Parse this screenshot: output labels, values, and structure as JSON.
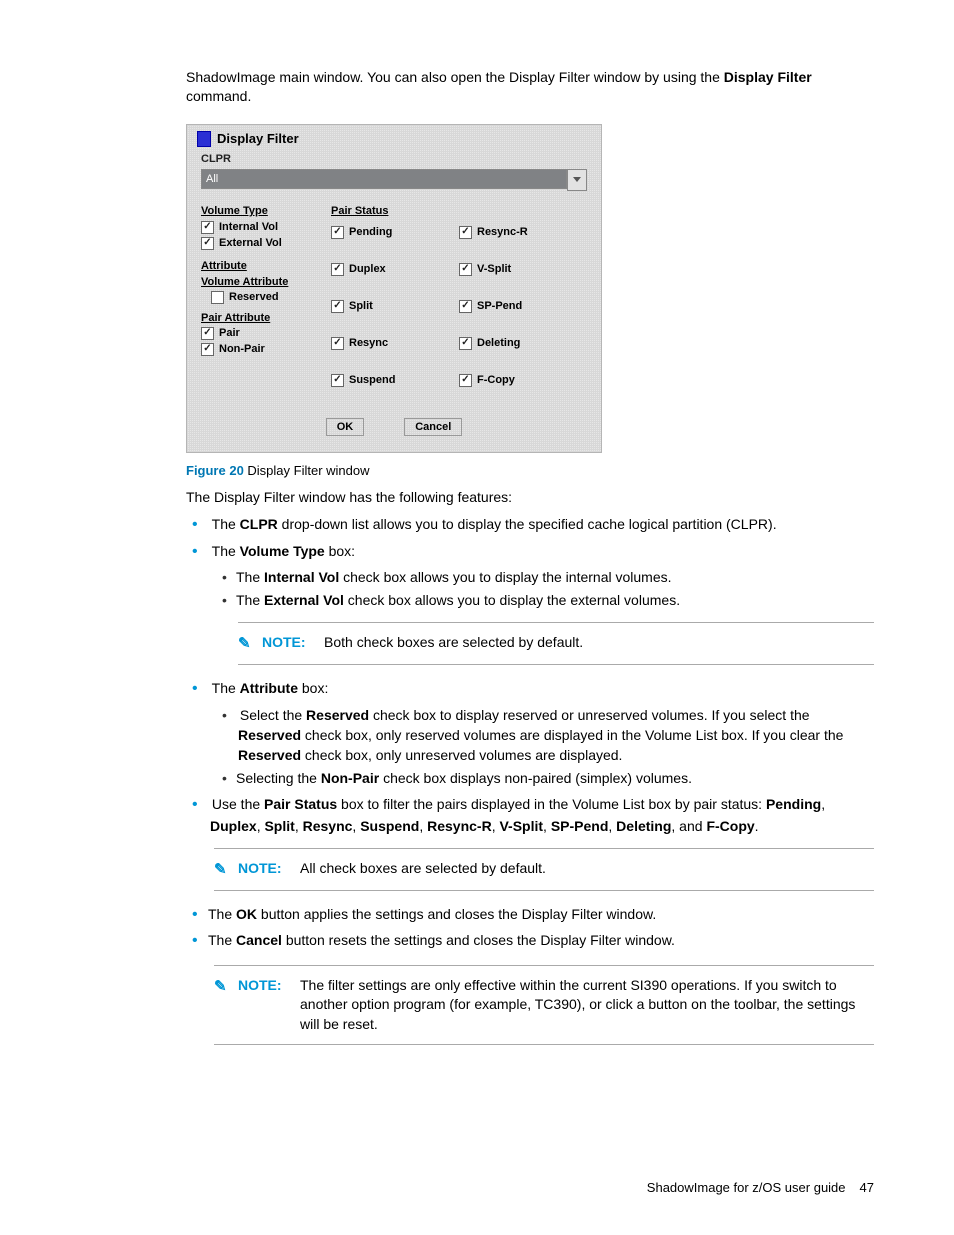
{
  "intro": {
    "text_a": "ShadowImage main window. You can also open the Display Filter window by using the ",
    "bold": "Display Filter",
    "text_b": " command."
  },
  "dialog": {
    "title": "Display Filter",
    "clpr_label": "CLPR",
    "clpr_value": "All",
    "volume_type": {
      "heading": "Volume Type",
      "internal": "Internal Vol",
      "external": "External Vol"
    },
    "attribute_h": "Attribute",
    "vol_attr_h": "Volume Attribute",
    "reserved": "Reserved",
    "pair_attr_h": "Pair Attribute",
    "pair": "Pair",
    "nonpair": "Non-Pair",
    "pair_status_h": "Pair Status",
    "ps": {
      "pending": "Pending",
      "resyncr": "Resync-R",
      "duplex": "Duplex",
      "vsplit": "V-Split",
      "split": "Split",
      "sppend": "SP-Pend",
      "resync": "Resync",
      "deleting": "Deleting",
      "suspend": "Suspend",
      "fcopy": "F-Copy"
    },
    "ok": "OK",
    "cancel": "Cancel"
  },
  "figure": {
    "num": "Figure 20",
    "caption": " Display Filter window"
  },
  "lead": "The Display Filter window has the following features:",
  "b1": {
    "a": "The ",
    "b": "CLPR",
    "c": " drop-down list allows you to display the specified cache logical partition (CLPR)."
  },
  "b2": {
    "a": "The ",
    "b": "Volume Type",
    "c": " box:"
  },
  "b2a": {
    "a": "The ",
    "b": "Internal Vol",
    "c": " check box allows you to display the internal volumes."
  },
  "b2b": {
    "a": "The ",
    "b": "External Vol",
    "c": " check box allows you to display the external volumes."
  },
  "note1": "Both check boxes are selected by default.",
  "b3": {
    "a": "The ",
    "b": "Attribute",
    "c": " box:"
  },
  "b3a": {
    "a": "Select the ",
    "b": "Reserved",
    "c": " check box to display reserved or unreserved volumes. If you select the ",
    "d": "Reserved",
    "e": " check box, only reserved volumes are displayed in the Volume List box. If you clear the ",
    "f": "Reserved",
    "g": " check box, only unreserved volumes are displayed."
  },
  "b3b": {
    "a": "Selecting the ",
    "b": "Non-Pair",
    "c": " check box displays non-paired (simplex) volumes."
  },
  "b4": {
    "a": "Use the ",
    "b": "Pair Status",
    "c": " box to filter the pairs displayed in the Volume List box by pair status: ",
    "list": [
      "Pending",
      "Duplex",
      "Split",
      "Resync",
      "Suspend",
      "Resync-R",
      "V-Split",
      "SP-Pend",
      "Deleting",
      "F-Copy"
    ],
    "tail": "."
  },
  "note2": "All check boxes are selected by default.",
  "b5": {
    "a": "The ",
    "b": "OK",
    "c": " button applies the settings and closes the Display Filter window."
  },
  "b6": {
    "a": "The ",
    "b": "Cancel",
    "c": " button resets the settings and closes the Display Filter window."
  },
  "note3": "The filter settings are only effective within the current SI390 operations. If you switch to another option program (for example, TC390), or click a button on the toolbar, the settings will be reset.",
  "note_label": "NOTE:",
  "footer": {
    "title": "ShadowImage for z/OS user guide",
    "page": "47"
  }
}
